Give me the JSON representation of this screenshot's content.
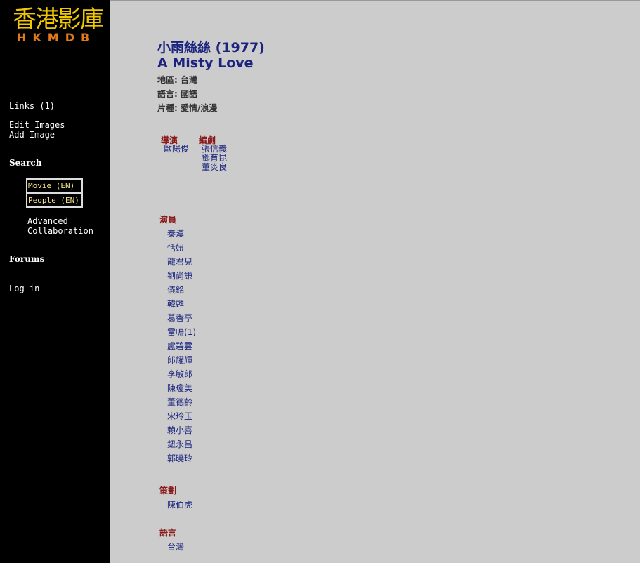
{
  "logo": {
    "cn": "香港影庫",
    "en": "HKMDB"
  },
  "sidebar": {
    "links": "Links (1)",
    "edit_images": "Edit Images",
    "add_image": "Add Image",
    "search_heading": "Search",
    "search_movie": "Movie (EN)",
    "search_people": "People (EN)",
    "advanced": "Advanced",
    "collaboration": "Collaboration",
    "forums": "Forums",
    "login": "Log in"
  },
  "movie": {
    "title_cn": "小雨絲絲 (1977)",
    "title_en": "A Misty Love",
    "region": "地區: 台灣",
    "language": "語言: 國語",
    "genre": "片種: 愛情/浪漫"
  },
  "crew": {
    "director_heading": "導演",
    "director_names": [
      "歐陽俊"
    ],
    "writer_heading": "編劇",
    "writer_names": [
      "張信義",
      "鄧育昆",
      "董炎良"
    ]
  },
  "cast": {
    "heading": "演員",
    "names": [
      "秦漢",
      "恬妞",
      "龍君兒",
      "劉尚謙",
      "儀銘",
      "韓甦",
      "葛香亭",
      "雷鳴",
      "盧碧雲",
      "郎耀輝",
      "李敏郎",
      "陳瓊美",
      "董德齡",
      "宋玲玉",
      "賴小喜",
      "鈕永昌",
      "郭曉玲"
    ],
    "leimin_count": "(1)"
  },
  "planning": {
    "heading": "策劃",
    "names": [
      "陳伯虎"
    ]
  },
  "language_section": {
    "heading": "語言",
    "names": [
      "台灣"
    ]
  }
}
